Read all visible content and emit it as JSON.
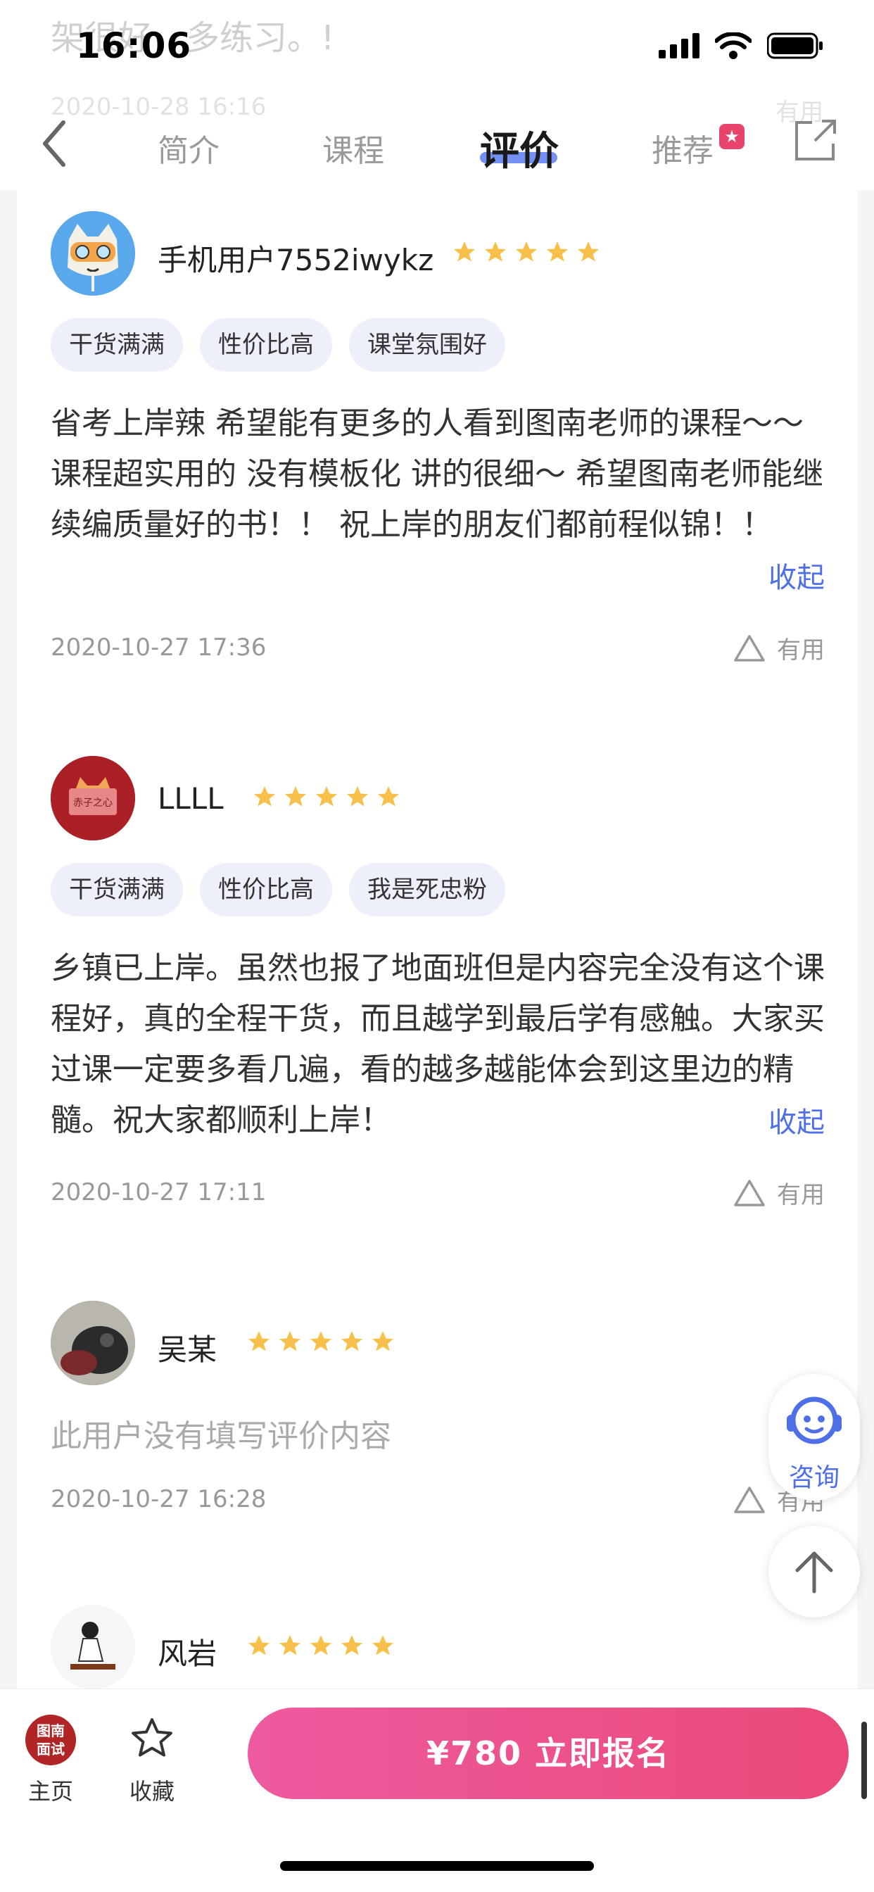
{
  "status": {
    "time": "16:06"
  },
  "ghost": {
    "top_text": "架很好，多练习。!",
    "top_date": "2020-10-28 16:16",
    "top_useful": "有用"
  },
  "nav": {
    "tabs": [
      {
        "label": "简介"
      },
      {
        "label": "课程"
      },
      {
        "label": "评价",
        "active": true
      },
      {
        "label": "推荐"
      }
    ],
    "accent": "#5b7cf0"
  },
  "reviews": [
    {
      "user": "手机用户7552iwykz",
      "rating": 5,
      "tags": [
        "干货满满",
        "性价比高",
        "课堂氛围好"
      ],
      "text": "省考上岸辣 希望能有更多的人看到图南老师的课程～～课程超实用的 没有模板化 讲的很细～ 希望图南老师能继续编质量好的书！！ 祝上岸的朋友们都前程似锦！！",
      "fold_label": "收起",
      "date": "2020-10-27 17:36",
      "useful": "有用"
    },
    {
      "user": "LLLL",
      "rating": 5,
      "avatar_text": "赤子之心",
      "tags": [
        "干货满满",
        "性价比高",
        "我是死忠粉"
      ],
      "text": "乡镇已上岸。虽然也报了地面班但是内容完全没有这个课程好，真的全程干货，而且越学到最后学有感触。大家买过课一定要多看几遍，看的越多越能体会到这里边的精髓。祝大家都顺利上岸！",
      "fold_label": "收起",
      "date": "2020-10-27 17:11",
      "useful": "有用"
    },
    {
      "user": "吴某",
      "rating": 5,
      "empty_text": "此用户没有填写评价内容",
      "date": "2020-10-27 16:28",
      "useful": "有用"
    },
    {
      "user": "风岩",
      "rating": 5
    }
  ],
  "floating": {
    "consult_label": "咨询"
  },
  "bottom": {
    "home_logo_text": "图南面试",
    "home_logo_line1": "图南",
    "home_logo_line2": "面试",
    "home_label": "主页",
    "fav_label": "收藏",
    "signup_label": "¥780  立即报名",
    "signup_color": "#ea4a78"
  },
  "colors": {
    "star": "#f7c04a",
    "link": "#4f6fe8",
    "tag_bg": "#edf0fb"
  }
}
